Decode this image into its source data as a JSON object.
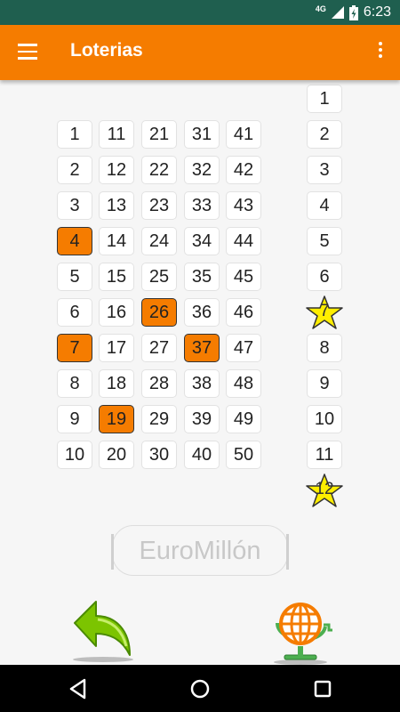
{
  "status_bar": {
    "network": "4G",
    "time": "6:23",
    "icons": [
      "signal-icon",
      "battery-charging-icon"
    ]
  },
  "app_bar": {
    "title": "Loterias",
    "icons": [
      "hamburger-menu-icon",
      "overflow-menu-icon"
    ]
  },
  "colors": {
    "accent": "#f57c00",
    "status_bar": "#1f5f4f",
    "selected": "#f57c00",
    "star": "#ffee00"
  },
  "numbers": {
    "columns": [
      [
        "1",
        "2",
        "3",
        "4",
        "5",
        "6",
        "7",
        "8",
        "9",
        "10"
      ],
      [
        "11",
        "12",
        "13",
        "14",
        "15",
        "16",
        "17",
        "18",
        "19",
        "20"
      ],
      [
        "21",
        "22",
        "23",
        "24",
        "25",
        "26",
        "27",
        "28",
        "29",
        "30"
      ],
      [
        "31",
        "32",
        "33",
        "34",
        "35",
        "36",
        "37",
        "38",
        "39",
        "40"
      ],
      [
        "41",
        "42",
        "43",
        "44",
        "45",
        "46",
        "47",
        "48",
        "49",
        "50"
      ]
    ],
    "selected": [
      "4",
      "7",
      "19",
      "26",
      "37"
    ]
  },
  "stars": {
    "items": [
      "1",
      "2",
      "3",
      "4",
      "5",
      "6",
      "7",
      "8",
      "9",
      "10",
      "11",
      "12"
    ],
    "selected": [
      "7",
      "12"
    ]
  },
  "game_label": "EuroMillón",
  "bottom_buttons": {
    "back_icon": "back-arrow-icon",
    "draw_icon": "lottery-globe-icon"
  },
  "nav_bar": {
    "icons": [
      "back-triangle-icon",
      "home-circle-icon",
      "recents-square-icon"
    ]
  }
}
